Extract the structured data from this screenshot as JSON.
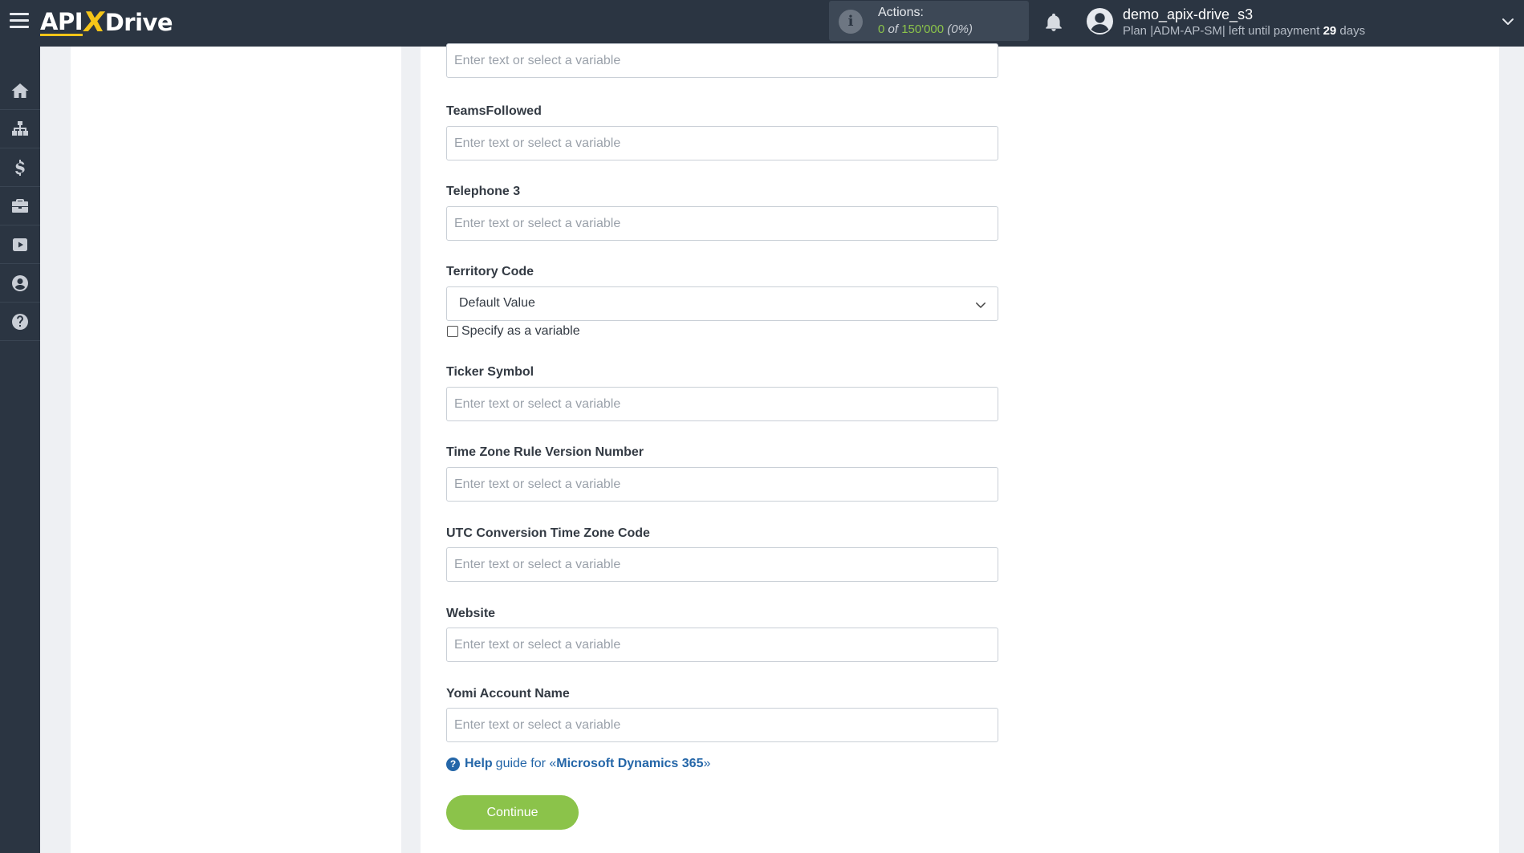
{
  "header": {
    "logo": {
      "part1": "API",
      "part2": "X",
      "part3": "Drive"
    },
    "actions": {
      "label": "Actions:",
      "used": "0",
      "of": "of",
      "total": "150'000",
      "percent": "(0%)"
    },
    "user": {
      "name": "demo_apix-drive_s3",
      "plan_prefix": "Plan |ADM-AP-SM| left until payment",
      "days": "29",
      "days_suffix": "days"
    }
  },
  "sidebar": {
    "items": [
      {
        "icon": "home-icon"
      },
      {
        "icon": "sitemap-icon"
      },
      {
        "icon": "dollar-icon"
      },
      {
        "icon": "briefcase-icon"
      },
      {
        "icon": "youtube-icon"
      },
      {
        "icon": "user-circle-icon"
      },
      {
        "icon": "question-circle-icon"
      }
    ]
  },
  "form": {
    "placeholder": "Enter text or select a variable",
    "fields": [
      {
        "label": "TeamsFollowed"
      },
      {
        "label": "Telephone 3"
      },
      {
        "label": "Territory Code",
        "select_value": "Default Value",
        "checkbox_label": "Specify as a variable"
      },
      {
        "label": "Ticker Symbol"
      },
      {
        "label": "Time Zone Rule Version Number"
      },
      {
        "label": "UTC Conversion Time Zone Code"
      },
      {
        "label": "Website"
      },
      {
        "label": "Yomi Account Name"
      }
    ],
    "help": {
      "help_word": "Help",
      "guide_text": "guide for «",
      "service": "Microsoft Dynamics 365",
      "close": "»"
    },
    "continue_label": "Continue"
  },
  "colors": {
    "topbar": "#2b3542",
    "accent_green": "#8bc34a",
    "link_blue": "#2466a8",
    "logo_yellow": "#f5c518"
  }
}
